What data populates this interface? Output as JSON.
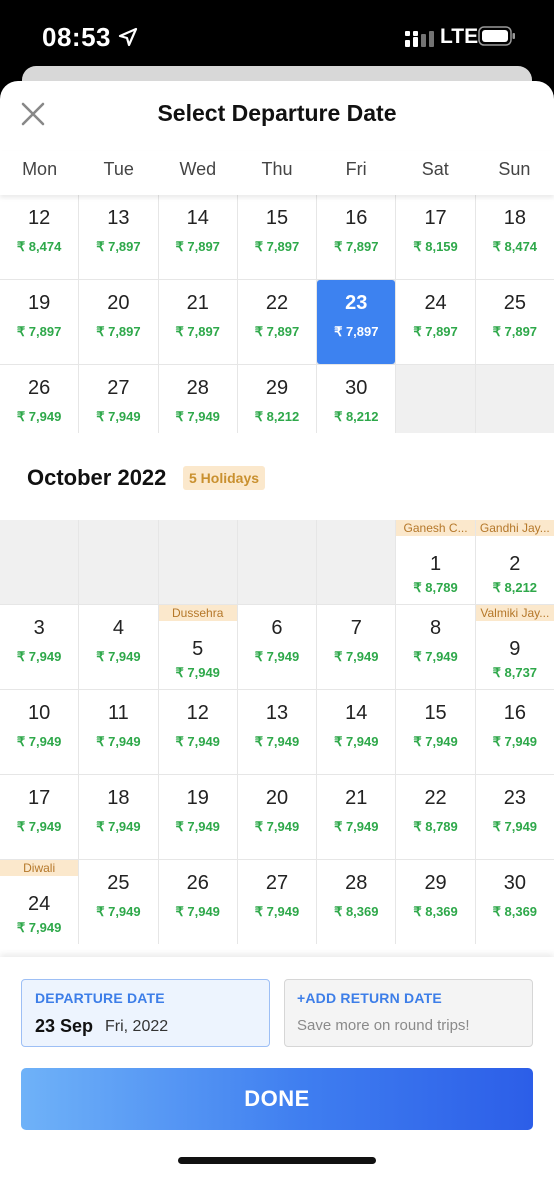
{
  "status_bar": {
    "time": "08:53",
    "network": "LTE"
  },
  "header": {
    "title": "Select Departure Date"
  },
  "weekdays": [
    "Mon",
    "Tue",
    "Wed",
    "Thu",
    "Fri",
    "Sat",
    "Sun"
  ],
  "september": {
    "weeks": [
      [
        {
          "day": "12",
          "price": "₹ 8,474"
        },
        {
          "day": "13",
          "price": "₹ 7,897"
        },
        {
          "day": "14",
          "price": "₹ 7,897"
        },
        {
          "day": "15",
          "price": "₹ 7,897"
        },
        {
          "day": "16",
          "price": "₹ 7,897"
        },
        {
          "day": "17",
          "price": "₹ 8,159"
        },
        {
          "day": "18",
          "price": "₹ 8,474"
        }
      ],
      [
        {
          "day": "19",
          "price": "₹ 7,897"
        },
        {
          "day": "20",
          "price": "₹ 7,897"
        },
        {
          "day": "21",
          "price": "₹ 7,897"
        },
        {
          "day": "22",
          "price": "₹ 7,897"
        },
        {
          "day": "23",
          "price": "₹ 7,897",
          "selected": true
        },
        {
          "day": "24",
          "price": "₹ 7,897"
        },
        {
          "day": "25",
          "price": "₹ 7,897"
        }
      ],
      [
        {
          "day": "26",
          "price": "₹ 7,949"
        },
        {
          "day": "27",
          "price": "₹ 7,949"
        },
        {
          "day": "28",
          "price": "₹ 7,949"
        },
        {
          "day": "29",
          "price": "₹ 8,212"
        },
        {
          "day": "30",
          "price": "₹ 8,212"
        },
        null,
        null
      ]
    ]
  },
  "october": {
    "title": "October 2022",
    "holidays_badge": "5 Holidays",
    "weeks": [
      [
        null,
        null,
        null,
        null,
        null,
        {
          "day": "1",
          "price": "₹ 8,789",
          "holiday": "Ganesh C..."
        },
        {
          "day": "2",
          "price": "₹ 8,212",
          "holiday": "Gandhi Jay..."
        }
      ],
      [
        {
          "day": "3",
          "price": "₹ 7,949"
        },
        {
          "day": "4",
          "price": "₹ 7,949"
        },
        {
          "day": "5",
          "price": "₹ 7,949",
          "holiday": "Dussehra"
        },
        {
          "day": "6",
          "price": "₹ 7,949"
        },
        {
          "day": "7",
          "price": "₹ 7,949"
        },
        {
          "day": "8",
          "price": "₹ 7,949"
        },
        {
          "day": "9",
          "price": "₹ 8,737",
          "holiday": "Valmiki Jay..."
        }
      ],
      [
        {
          "day": "10",
          "price": "₹ 7,949"
        },
        {
          "day": "11",
          "price": "₹ 7,949"
        },
        {
          "day": "12",
          "price": "₹ 7,949"
        },
        {
          "day": "13",
          "price": "₹ 7,949"
        },
        {
          "day": "14",
          "price": "₹ 7,949"
        },
        {
          "day": "15",
          "price": "₹ 7,949"
        },
        {
          "day": "16",
          "price": "₹ 7,949"
        }
      ],
      [
        {
          "day": "17",
          "price": "₹ 7,949"
        },
        {
          "day": "18",
          "price": "₹ 7,949"
        },
        {
          "day": "19",
          "price": "₹ 7,949"
        },
        {
          "day": "20",
          "price": "₹ 7,949"
        },
        {
          "day": "21",
          "price": "₹ 7,949"
        },
        {
          "day": "22",
          "price": "₹ 8,789"
        },
        {
          "day": "23",
          "price": "₹ 7,949"
        }
      ],
      [
        {
          "day": "24",
          "price": "₹ 7,949",
          "holiday": "Diwali"
        },
        {
          "day": "25",
          "price": "₹ 7,949"
        },
        {
          "day": "26",
          "price": "₹ 7,949"
        },
        {
          "day": "27",
          "price": "₹ 7,949"
        },
        {
          "day": "28",
          "price": "₹ 8,369"
        },
        {
          "day": "29",
          "price": "₹ 8,369"
        },
        {
          "day": "30",
          "price": "₹ 8,369"
        }
      ]
    ]
  },
  "departure": {
    "label": "DEPARTURE DATE",
    "date": "23 Sep",
    "weekday_year": "Fri, 2022"
  },
  "return": {
    "label": "+ADD RETURN DATE",
    "subtitle": "Save more on round trips!"
  },
  "done_label": "DONE",
  "colors": {
    "accent": "#3d82f0",
    "price_green": "#2ea84a",
    "holiday_bg": "#fbe8cc",
    "holiday_text": "#b5782a"
  },
  "icons": {
    "close": "close-icon",
    "location": "location-arrow-icon",
    "signal": "signal-icon",
    "battery": "battery-icon"
  }
}
